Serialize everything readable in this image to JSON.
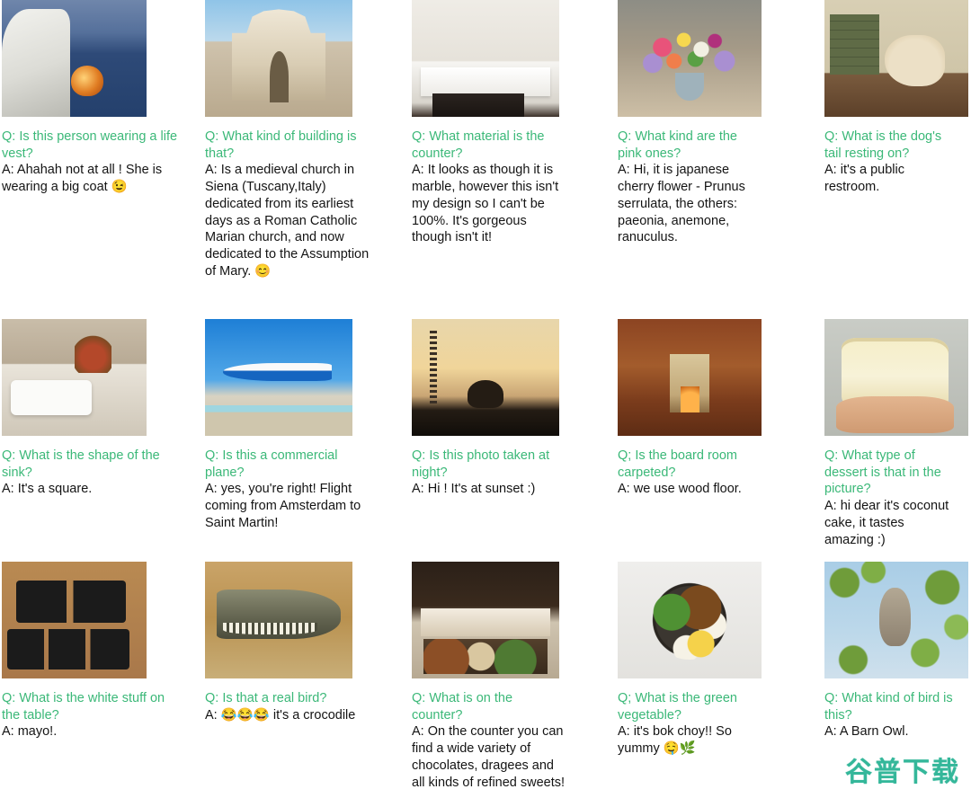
{
  "watermark": {
    "text": "谷普下载",
    "color": "#34b79a"
  },
  "theme": {
    "question_color": "#3bb878",
    "answer_color": "#141414",
    "background": "#ffffff"
  },
  "grid": {
    "columns": 5,
    "rows": 3
  },
  "items": [
    {
      "image_name": "man-on-boat-at-dusk",
      "question": "Q: Is this person wearing a life vest?",
      "answer": "A: Ahahah not at all ! She is wearing a big coat 😉"
    },
    {
      "image_name": "siena-cathedral",
      "question": "Q: What kind of building is that?",
      "answer": "A: Is a medieval church in Siena (Tuscany,Italy) dedicated from its earliest days as a Roman Catholic Marian church, and now dedicated to the Assumption of Mary. 😊"
    },
    {
      "image_name": "white-marble-kitchen-counter",
      "question": "Q: What material is the counter?",
      "answer": "A: It looks as though it is marble, however this isn't my design so I can't be 100%. It's gorgeous though isn't it!"
    },
    {
      "image_name": "flower-arrangement",
      "question": "Q: What kind are the pink ones?",
      "answer": "A: Hi, it is japanese cherry flower - Prunus serrulata, the others: paeonia, anemone, ranuculus."
    },
    {
      "image_name": "dog-on-vet-table",
      "question": "Q: What is the dog's tail resting on?",
      "answer": "A: it's a public restroom."
    },
    {
      "image_name": "bathroom-sink",
      "question": "Q: What is the shape of the sink?",
      "answer": "A: It's a square."
    },
    {
      "image_name": "klm-airplane-landing",
      "question": "Q: Is this a commercial plane?",
      "answer": "A: yes, you're right! Flight coming from Amsterdam to Saint Martin!"
    },
    {
      "image_name": "sunset-over-field",
      "question": "Q: Is this photo taken at night?",
      "answer": "A: Hi ! It's at sunset :)"
    },
    {
      "image_name": "board-room-with-fireplace",
      "question": "Q; Is the board room carpeted?",
      "answer": "A: we use wood floor."
    },
    {
      "image_name": "coconut-cake-slice",
      "question": "Q: What type of dessert is that in the picture?",
      "answer": "A: hi dear it's coconut cake, it tastes amazing :)"
    },
    {
      "image_name": "black-sauce-dishes-on-table",
      "question": "Q: What is the white stuff on the table?",
      "answer": "A: mayo!."
    },
    {
      "image_name": "crocodile-head",
      "question": "Q: Is that a real bird?",
      "answer": "A: 😂😂😂 it's a crocodile"
    },
    {
      "image_name": "chocolate-shop-counter",
      "question": "Q: What is on the counter?",
      "answer": "A: On the counter you can find a wide variety of chocolates, dragees and all kinds of refined sweets!"
    },
    {
      "image_name": "bok-choy-rice-bowl",
      "question": "Q; What is the green vegetable?",
      "answer": "A: it's bok choy!! So yummy 🤤🌿"
    },
    {
      "image_name": "barn-owl-in-tree",
      "question": "Q: What kind of bird is this?",
      "answer": "A: A Barn Owl."
    }
  ]
}
